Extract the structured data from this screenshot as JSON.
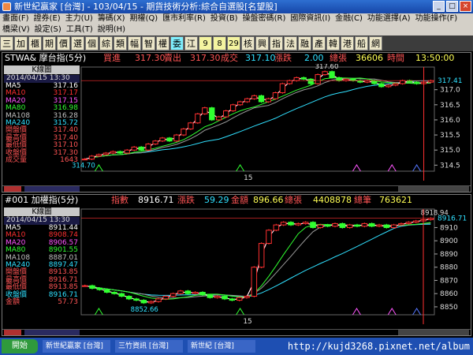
{
  "window": {
    "title": "新世紀贏家 [台灣] - 103/04/15 - 期貨技術分析:綜合自選股[名望股]"
  },
  "menu1": [
    "畫面(F)",
    "證券(E)",
    "主力(U)",
    "籌碼(X)",
    "期權(Q)",
    "匯市利率(R)",
    "投資(B)",
    "操盤密碼(R)",
    "國際資訊(I)",
    "金融(C)",
    "功能選擇(A)",
    "功能操作(F)"
  ],
  "menu2": [
    "橋梁(V)",
    "設定(S)",
    "工具(T)",
    "說明(H)"
  ],
  "toolbar": [
    {
      "label": "三",
      "hl": false
    },
    {
      "label": "加",
      "hl": false
    },
    {
      "label": "櫃",
      "hl": false
    },
    {
      "label": "期",
      "hl": false
    },
    {
      "label": "價",
      "hl": false
    },
    {
      "label": "選",
      "hl": false
    },
    {
      "label": "個",
      "hl": false
    },
    {
      "label": "綜",
      "hl": false
    },
    {
      "label": "類",
      "hl": false
    },
    {
      "label": "幅",
      "hl": false
    },
    {
      "label": "智",
      "hl": false
    },
    {
      "label": "權",
      "hl": false
    },
    {
      "label": "委",
      "hl": true
    },
    {
      "label": "江",
      "hl": false
    },
    {
      "label": "9",
      "hl": false,
      "num": true
    },
    {
      "label": "8",
      "hl": false,
      "num": true
    },
    {
      "label": "29",
      "hl": false,
      "num": true
    },
    {
      "label": "核",
      "hl": false
    },
    {
      "label": "興",
      "hl": false
    },
    {
      "label": "指",
      "hl": false
    },
    {
      "label": "法",
      "hl": false
    },
    {
      "label": "融",
      "hl": false
    },
    {
      "label": "產",
      "hl": false
    },
    {
      "label": "韓",
      "hl": false
    },
    {
      "label": "港",
      "hl": false
    },
    {
      "label": "船",
      "hl": false
    },
    {
      "label": "網",
      "hl": false
    }
  ],
  "panel1": {
    "header": {
      "name": "STWA&  摩台指(5分)",
      "buy_label": "買進",
      "buy": "317.30",
      "sell_label": "賣出",
      "sell": "317.30",
      "deal_label": "成交",
      "deal": "317.10",
      "chg_label": "漲跌",
      "chg": "2.00",
      "vol_label": "總張",
      "vol": "36606",
      "time_label": "時間",
      "time": "13:50:00"
    },
    "ktitle": "K線圖",
    "date": "2014/04/15 13:30",
    "rows": [
      {
        "label": "MA5",
        "value": "317.16",
        "color": "#ffffff"
      },
      {
        "label": "MA10",
        "value": "317.17",
        "color": "#ff3030"
      },
      {
        "label": "MA20",
        "value": "317.15",
        "color": "#ff55ff"
      },
      {
        "label": "MA80",
        "value": "316.98",
        "color": "#30ff30"
      },
      {
        "label": "MA108",
        "value": "316.28",
        "color": "#c0c0c0"
      },
      {
        "label": "MA240",
        "value": "315.72",
        "color": "#30e0ff"
      },
      {
        "label": "開盤價",
        "value": "317.40",
        "color": "#ff5555"
      },
      {
        "label": "最高價",
        "value": "317.40",
        "color": "#ff5555"
      },
      {
        "label": "最低價",
        "value": "317.10",
        "color": "#ff5555"
      },
      {
        "label": "收盤價",
        "value": "317.30",
        "color": "#ff5555"
      },
      {
        "label": "成交量",
        "value": "1643",
        "color": "#ff5555"
      }
    ],
    "chart_data": {
      "type": "line",
      "ylim": [
        314.3,
        317.75
      ],
      "yticks": [
        "317.0",
        "316.5",
        "316.0",
        "315.5",
        "315.0",
        "314.5"
      ],
      "last_price_label": "317.41",
      "high_label": "317.60",
      "low_label": "314.70",
      "x_tick_label": "15",
      "close": [
        314.7,
        314.8,
        314.85,
        314.9,
        314.95,
        314.9,
        315.0,
        315.1,
        315.0,
        315.2,
        315.3,
        315.4,
        315.3,
        315.5,
        315.7,
        315.9,
        316.2,
        316.4,
        316.0,
        316.1,
        316.3,
        316.5,
        316.6,
        316.7,
        316.8,
        316.6,
        316.7,
        316.9,
        317.2,
        317.3,
        317.4,
        317.35,
        317.2,
        317.5,
        317.6,
        317.4,
        317.3,
        317.35,
        317.3,
        317.25,
        317.3,
        317.2,
        317.1,
        317.15,
        317.2,
        317.3,
        317.25,
        317.2,
        317.25,
        317.3
      ]
    }
  },
  "panel2": {
    "header": {
      "name": "#001  加權指(5分)",
      "idx_label": "指數",
      "idx": "8916.71",
      "chg_label": "漲跌",
      "chg": "59.29",
      "amt_label": "金額",
      "amt": "896.66",
      "vol_label": "總張",
      "vol": "4408878",
      "cnt_label": "總筆",
      "cnt": "763621"
    },
    "ktitle": "K線圖",
    "date": "2014/04/15 13:30",
    "rows": [
      {
        "label": "MA5",
        "value": "8911.44",
        "color": "#ffffff"
      },
      {
        "label": "MA10",
        "value": "8908.74",
        "color": "#ff3030"
      },
      {
        "label": "MA20",
        "value": "8906.57",
        "color": "#ff55ff"
      },
      {
        "label": "MA80",
        "value": "8901.55",
        "color": "#30ff30"
      },
      {
        "label": "MA108",
        "value": "8887.01",
        "color": "#c0c0c0"
      },
      {
        "label": "MA240",
        "value": "8897.47",
        "color": "#30e0ff"
      },
      {
        "label": "開盤價",
        "value": "8913.85",
        "color": "#ff5555"
      },
      {
        "label": "最高價",
        "value": "8916.71",
        "color": "#ff5555"
      },
      {
        "label": "最低價",
        "value": "8913.85",
        "color": "#ff5555"
      },
      {
        "label": "收盤價",
        "value": "8916.71",
        "color": "#30e0ff"
      },
      {
        "label": "金額",
        "value": "57.73",
        "color": "#ff5555"
      }
    ],
    "chart_data": {
      "type": "line",
      "ylim": [
        8844,
        8924
      ],
      "yticks": [
        "8910",
        "8900",
        "8890",
        "8880",
        "8870",
        "8860",
        "8850"
      ],
      "last_price_label": "8916.71",
      "high_label": "8918.94",
      "low_label": "8852.66",
      "x_tick_label": "15",
      "close": [
        8866,
        8864,
        8863,
        8861,
        8860,
        8858,
        8856,
        8855,
        8853,
        8854,
        8856,
        8858,
        8860,
        8862,
        8860,
        8861,
        8859,
        8857,
        8858,
        8856,
        8855,
        8857,
        8858,
        8880,
        8898,
        8908,
        8912,
        8914,
        8912,
        8913,
        8914,
        8910,
        8912,
        8911,
        8913,
        8910,
        8912,
        8911,
        8913,
        8911,
        8912,
        8910,
        8912,
        8913,
        8914,
        8915,
        8916,
        8917
      ]
    }
  },
  "taskbar": {
    "start": "開始",
    "tasks": [
      "新世紀贏家 [台灣]",
      "三竹資訊 [台灣]",
      "新世紀 [台灣]"
    ]
  },
  "watermark": "http://kujd3268.pixnet.net/album"
}
